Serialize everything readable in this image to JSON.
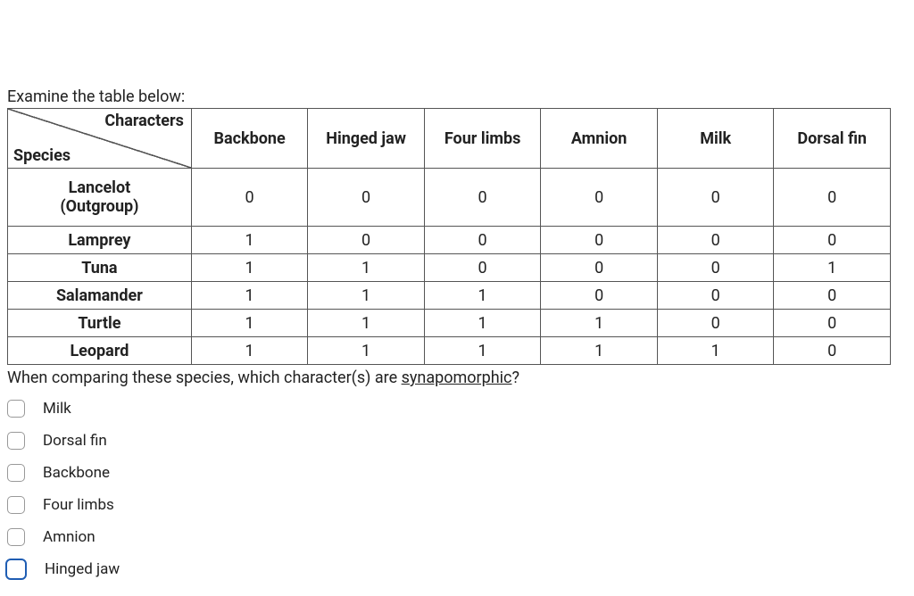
{
  "intro": "Examine the table below:",
  "corner": {
    "top_right": "Characters",
    "bottom_left": "Species"
  },
  "columns": [
    "Backbone",
    "Hinged jaw",
    "Four limbs",
    "Amnion",
    "Milk",
    "Dorsal fin"
  ],
  "rows": [
    {
      "species": "Lancelot (Outgroup)",
      "values": [
        0,
        0,
        0,
        0,
        0,
        0
      ],
      "tall": true
    },
    {
      "species": "Lamprey",
      "values": [
        1,
        0,
        0,
        0,
        0,
        0
      ]
    },
    {
      "species": "Tuna",
      "values": [
        1,
        1,
        0,
        0,
        0,
        1
      ]
    },
    {
      "species": "Salamander",
      "values": [
        1,
        1,
        1,
        0,
        0,
        0
      ]
    },
    {
      "species": "Turtle",
      "values": [
        1,
        1,
        1,
        1,
        0,
        0
      ]
    },
    {
      "species": "Leopard",
      "values": [
        1,
        1,
        1,
        1,
        1,
        0
      ]
    }
  ],
  "question_pre": "When comparing these species, which character(s) are ",
  "question_term": "synapomorphic",
  "question_post": "?",
  "options": [
    {
      "label": "Milk",
      "checked": false,
      "focused": false
    },
    {
      "label": "Dorsal fin",
      "checked": false,
      "focused": false
    },
    {
      "label": "Backbone",
      "checked": false,
      "focused": false
    },
    {
      "label": "Four limbs",
      "checked": false,
      "focused": false
    },
    {
      "label": "Amnion",
      "checked": false,
      "focused": false
    },
    {
      "label": "Hinged jaw",
      "checked": false,
      "focused": true
    }
  ]
}
